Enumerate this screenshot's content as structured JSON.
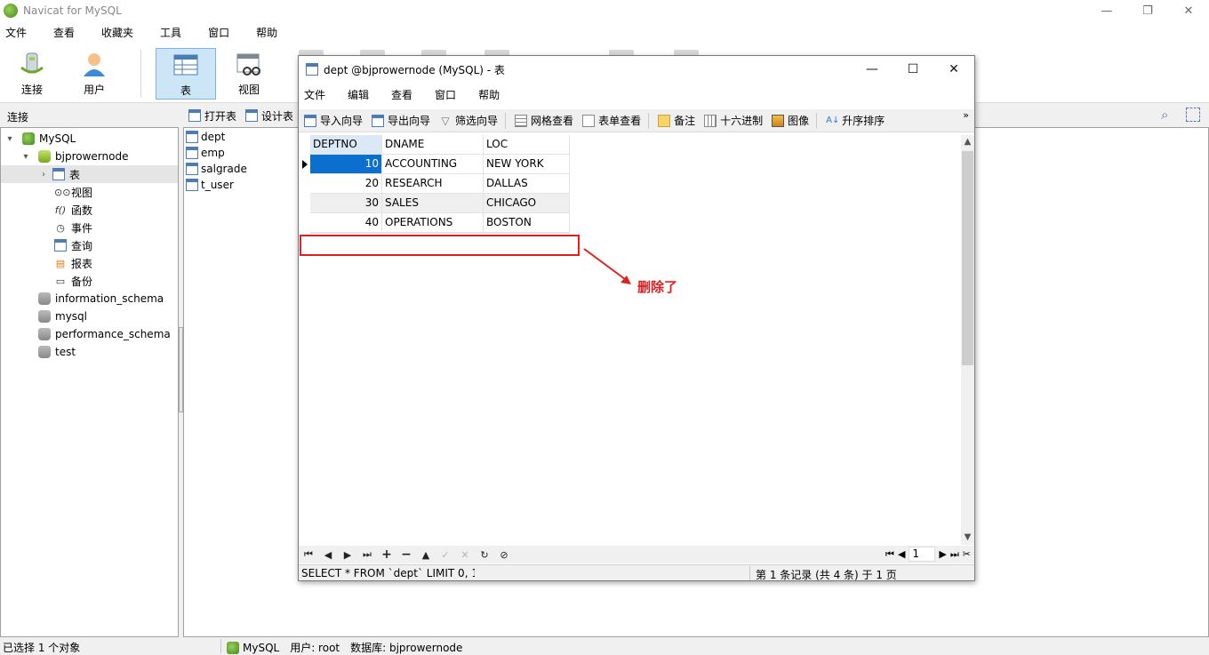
{
  "app": {
    "title": "Navicat for MySQL"
  },
  "window_controls": {
    "minimize": "—",
    "restore": "❐",
    "close": "✕"
  },
  "menu": [
    "文件",
    "查看",
    "收藏夹",
    "工具",
    "窗口",
    "帮助"
  ],
  "toolbar": {
    "buttons": [
      {
        "label": "连接",
        "icon": "connection-icon"
      },
      {
        "label": "用户",
        "icon": "user-icon"
      },
      {
        "label": "表",
        "icon": "table-icon",
        "active": true
      },
      {
        "label": "视图",
        "icon": "view-icon"
      }
    ]
  },
  "sidebar": {
    "header": "连接",
    "tree": [
      {
        "label": "MySQL",
        "level": 0,
        "caret": "▾"
      },
      {
        "label": "bjprowernode",
        "level": 1,
        "caret": "▾"
      },
      {
        "label": "表",
        "level": 2,
        "caret": "›",
        "selected": true
      },
      {
        "label": "视图",
        "level": 2
      },
      {
        "label": "函数",
        "level": 2
      },
      {
        "label": "事件",
        "level": 2
      },
      {
        "label": "查询",
        "level": 2
      },
      {
        "label": "报表",
        "level": 2
      },
      {
        "label": "备份",
        "level": 2
      },
      {
        "label": "information_schema",
        "level": 1
      },
      {
        "label": "mysql",
        "level": 1
      },
      {
        "label": "performance_schema",
        "level": 1
      },
      {
        "label": "test",
        "level": 1
      }
    ]
  },
  "object_toolbar": {
    "open_table": "打开表",
    "design_table": "设计表"
  },
  "objects": [
    "dept",
    "emp",
    "salgrade",
    "t_user"
  ],
  "statusbar": {
    "selection": "已选择 1 个对象",
    "connection": "MySQL",
    "user": "用户: root",
    "database": "数据库: bjprowernode"
  },
  "child_window": {
    "title": "dept @bjprowernode (MySQL) - 表",
    "menu": [
      "文件",
      "编辑",
      "查看",
      "窗口",
      "帮助"
    ],
    "toolbar": [
      "导入向导",
      "导出向导",
      "筛选向导",
      "网格查看",
      "表单查看",
      "备注",
      "十六进制",
      "图像",
      "升序排序"
    ],
    "more": "»",
    "columns": [
      "DEPTNO",
      "DNAME",
      "LOC"
    ],
    "rows": [
      [
        "10",
        "ACCOUNTING",
        "NEW YORK"
      ],
      [
        "20",
        "RESEARCH",
        "DALLAS"
      ],
      [
        "30",
        "SALES",
        "CHICAGO"
      ],
      [
        "40",
        "OPERATIONS",
        "BOSTON"
      ]
    ],
    "annotation": "删除了",
    "page_number": "1",
    "sql": "SELECT * FROM `dept` LIMIT 0, 1(",
    "record_info": "第 1 条记录 (共 4 条) 于 1 页"
  },
  "colors": {
    "selection": "#0a6fcf",
    "annotation": "#e02020",
    "active_tool": "#cde6f7"
  }
}
